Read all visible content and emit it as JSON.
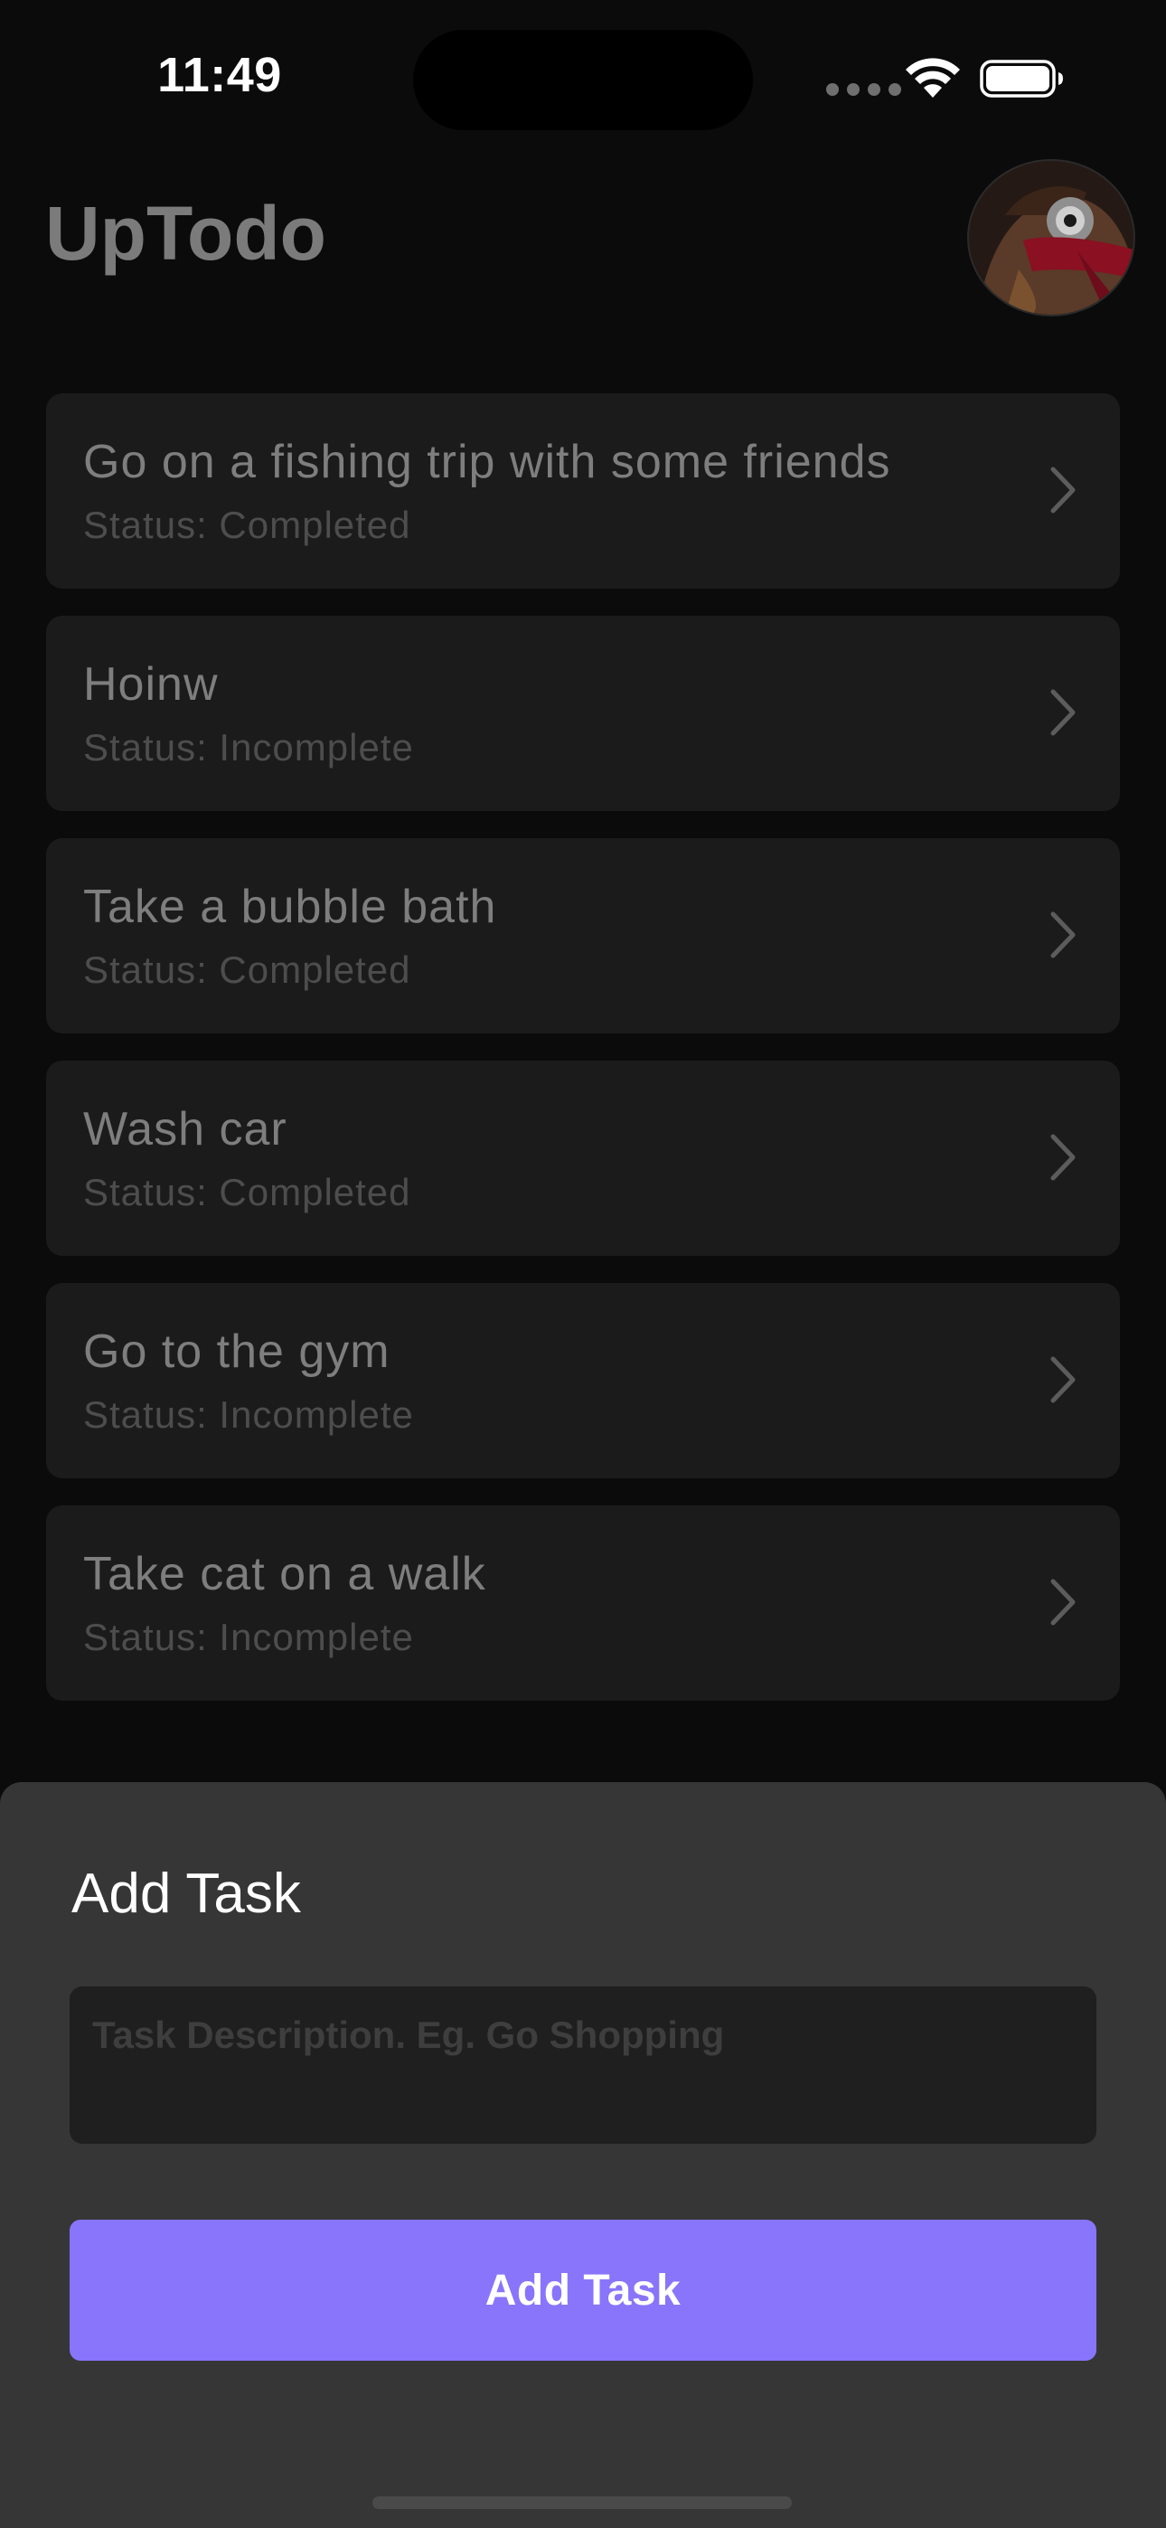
{
  "status_bar": {
    "time": "11:49"
  },
  "header": {
    "title": "UpTodo",
    "avatar": "profile-avatar"
  },
  "tasks": [
    {
      "title": "Go on a fishing trip with some friends",
      "status": "Status: Completed"
    },
    {
      "title": "Hoinw",
      "status": "Status: Incomplete"
    },
    {
      "title": "Take a bubble bath",
      "status": "Status: Completed"
    },
    {
      "title": "Wash car",
      "status": "Status: Completed"
    },
    {
      "title": "Go to the gym",
      "status": "Status: Incomplete"
    },
    {
      "title": "Take cat on a walk",
      "status": "Status: Incomplete"
    }
  ],
  "sheet": {
    "title": "Add Task",
    "input_placeholder": "Task Description. Eg. Go Shopping",
    "input_value": "",
    "button_label": "Add Task"
  },
  "colors": {
    "background": "#0b0b0b",
    "card": "#1b1b1b",
    "sheet": "#363636",
    "accent": "#8875fb"
  },
  "icons": {
    "chevron": "chevron-right-icon",
    "wifi": "wifi-icon",
    "battery": "battery-icon"
  }
}
